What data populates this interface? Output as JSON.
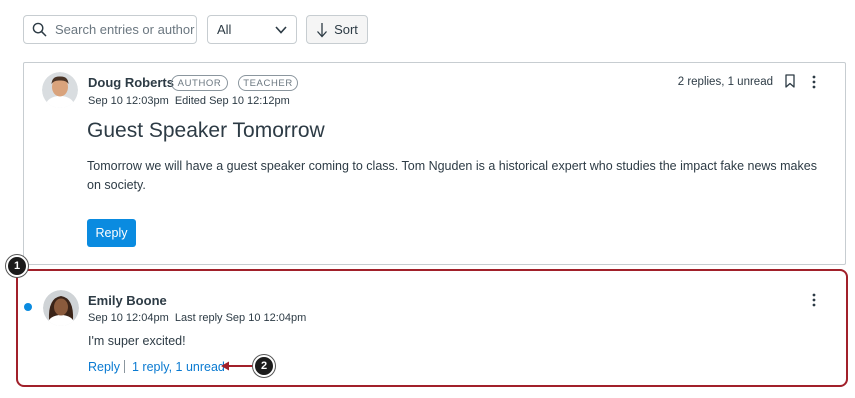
{
  "toolbar": {
    "search_placeholder": "Search entries or author",
    "filter_value": "All",
    "sort_label": "Sort"
  },
  "post": {
    "author": "Doug Roberts",
    "badges": [
      "AUTHOR",
      "TEACHER"
    ],
    "meta": "Sep 10 12:03pm  Edited Sep 10 12:12pm",
    "status": "2 replies, 1 unread",
    "title": "Guest Speaker Tomorrow",
    "body": "Tomorrow we will have a guest speaker coming to class. Tom Nguden is a historical expert who studies the impact fake news makes on society.",
    "reply_label": "Reply"
  },
  "reply": {
    "author": "Emily Boone",
    "meta": "Sep 10 12:04pm  Last reply Sep 10 12:04pm",
    "body": "I'm super excited!",
    "reply_label": "Reply",
    "replies_label": "1 reply, 1 unread"
  },
  "callouts": {
    "one": "1",
    "two": "2"
  },
  "colors": {
    "accent_blue": "#0a8be0",
    "highlight_red": "#a1202a",
    "text": "#2d3b45"
  }
}
